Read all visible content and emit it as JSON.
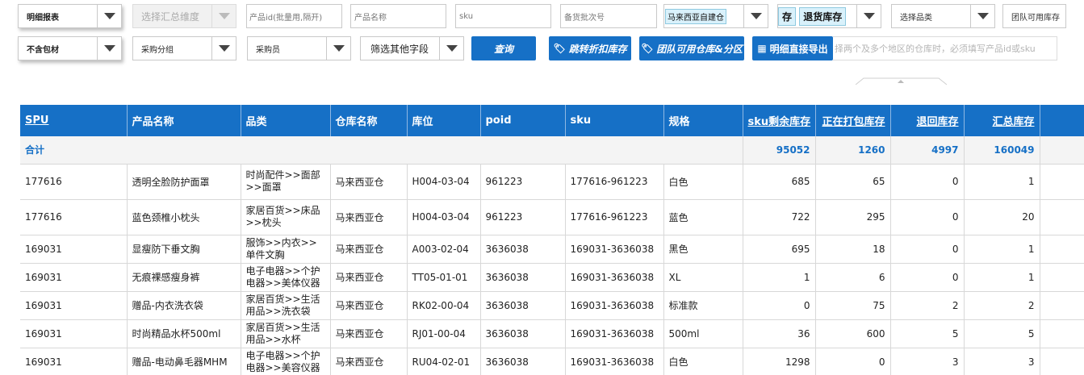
{
  "filters": {
    "report_type": "明细报表",
    "summary_dim_placeholder": "选择汇总维度",
    "product_id_placeholder": "产品id(批量用,隔开)",
    "product_name_placeholder": "产品名称",
    "sku_placeholder": "sku",
    "batch_no_placeholder": "备货批次号",
    "warehouse_tag": "马来西亚自建仓",
    "stock_tag_partial": "存",
    "stock_tag": "退货库存",
    "category_placeholder": "选择品类",
    "team_stock_placeholder": "团队可用库存",
    "packaging": "不含包材",
    "purchase_group_placeholder": "采购分组",
    "buyer_placeholder": "采购员",
    "other_fields_placeholder": "筛选其他字段"
  },
  "buttons": {
    "query": "查询",
    "discount_stock": "跳转折扣库存",
    "team_warehouse": "团队可用仓库&分区",
    "export": "明细直接导出"
  },
  "hint_text": "择两个及多个地区的仓库时，必须填写产品id或sku",
  "table": {
    "headers": [
      "SPU",
      "产品名称",
      "品类",
      "仓库名称",
      "库位",
      "poid",
      "sku",
      "规格",
      "sku剩余库存",
      "正在打包库存",
      "退回库存",
      "汇总库存"
    ],
    "total_row": {
      "label": "合计",
      "remaining": "95052",
      "packing": "1260",
      "returned": "4997",
      "total": "160049"
    },
    "rows": [
      {
        "spu": "177616",
        "name": "透明全脸防护面罩",
        "cat": "时尚配件>>面部>>面罩",
        "wh": "马来西亚仓",
        "loc": "H004-03-04",
        "poid": "961223",
        "sku": "177616-961223",
        "spec": "白色",
        "remaining": "685",
        "packing": "65",
        "returned": "0",
        "total": "1"
      },
      {
        "spu": "177616",
        "name": "蓝色颈椎小枕头",
        "cat": "家居百货>>床品>>枕头",
        "wh": "马来西亚仓",
        "loc": "H004-03-04",
        "poid": "961223",
        "sku": "177616-961223",
        "spec": "蓝色",
        "remaining": "722",
        "packing": "295",
        "returned": "0",
        "total": "20"
      },
      {
        "spu": "169031",
        "name": "显瘦防下垂文胸",
        "cat": "服饰>>内衣>>单件文胸",
        "wh": "马来西亚仓",
        "loc": "A003-02-04",
        "poid": "3636038",
        "sku": "169031-3636038",
        "spec": "黑色",
        "remaining": "695",
        "packing": "18",
        "returned": "0",
        "total": "1"
      },
      {
        "spu": "169031",
        "name": "无痕裸感瘦身裤",
        "cat": "电子电器>>个护电器>>美体仪器",
        "wh": "马来西亚仓",
        "loc": "TT05-01-01",
        "poid": "3636038",
        "sku": "169031-3636038",
        "spec": "XL",
        "remaining": "1",
        "packing": "6",
        "returned": "0",
        "total": "1"
      },
      {
        "spu": "169031",
        "name": "赠品-内衣洗衣袋",
        "cat": "家居百货>>生活用品>>洗衣袋",
        "wh": "马来西亚仓",
        "loc": "RK02-00-04",
        "poid": "3636038",
        "sku": "169031-3636038",
        "spec": "标准款",
        "remaining": "0",
        "packing": "75",
        "returned": "2",
        "total": "2"
      },
      {
        "spu": "169031",
        "name": "时尚精品水杯500ml",
        "cat": "家居百货>>生活用品>>水杯",
        "wh": "马来西亚仓",
        "loc": "RJ01-00-04",
        "poid": "3636038",
        "sku": "169031-3636038",
        "spec": "500ml",
        "remaining": "36",
        "packing": "600",
        "returned": "5",
        "total": "5"
      },
      {
        "spu": "169031",
        "name": "赠品-电动鼻毛器MHM",
        "cat": "电子电器>>个护电器>>美容仪器",
        "wh": "马来西亚仓",
        "loc": "RU04-02-01",
        "poid": "3636038",
        "sku": "169031-3636038",
        "spec": "白色",
        "remaining": "1298",
        "packing": "0",
        "returned": "3",
        "total": "3"
      }
    ]
  }
}
